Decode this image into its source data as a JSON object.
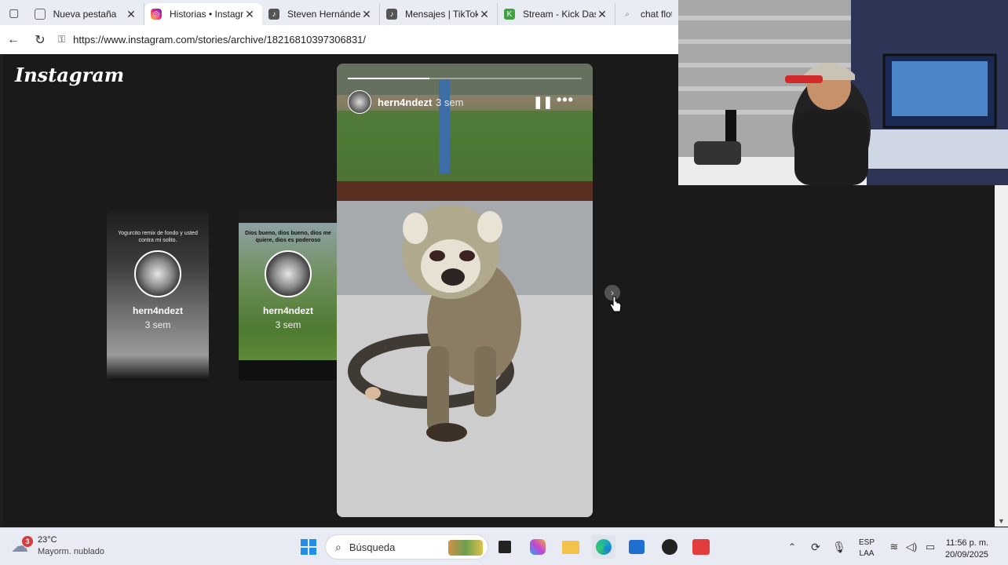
{
  "browser": {
    "tabs": [
      {
        "label": "Nueva pestaña",
        "icon": "new-tab-icon",
        "active": false
      },
      {
        "label": "Historias • Instagra",
        "icon": "instagram-icon",
        "active": true
      },
      {
        "label": "Steven Hernández",
        "icon": "tiktok-icon",
        "active": false
      },
      {
        "label": "Mensajes | TikTok",
        "icon": "tiktok-icon",
        "active": false
      },
      {
        "label": "Stream - Kick Dash",
        "icon": "kick-icon",
        "active": false
      },
      {
        "label": "chat flotan",
        "icon": "search-icon",
        "active": false
      }
    ],
    "url": "https://www.instagram.com/stories/archive/18216810397306831/"
  },
  "page": {
    "logo": "Instagram",
    "side_stories": [
      {
        "top_text": "Yogurcito remix de fondo y usted contra mi solito.",
        "username": "hern4ndezt",
        "time": "3 sem"
      },
      {
        "top_text": "Dios bueno, dios bueno, dios me quiere, dios es poderoso",
        "username": "hern4ndezt",
        "time": "3 sem"
      }
    ],
    "story": {
      "username": "hern4ndezt",
      "time": "3 sem",
      "progress": 0.35,
      "pause_icon": "pause-icon",
      "more_icon": "more-icon"
    }
  },
  "taskbar": {
    "weather": {
      "temp": "23°C",
      "condition": "Mayorm. nublado",
      "badge": "3"
    },
    "search_placeholder": "Búsqueda",
    "language": {
      "line1": "ESP",
      "line2": "LAA"
    },
    "clock": {
      "time": "11:56 p. m.",
      "date": "20/09/2025"
    }
  },
  "colors": {
    "accent": "#e1306c",
    "taskbar_bg": "#e8eaf4",
    "page_bg": "#1a1a1a"
  }
}
